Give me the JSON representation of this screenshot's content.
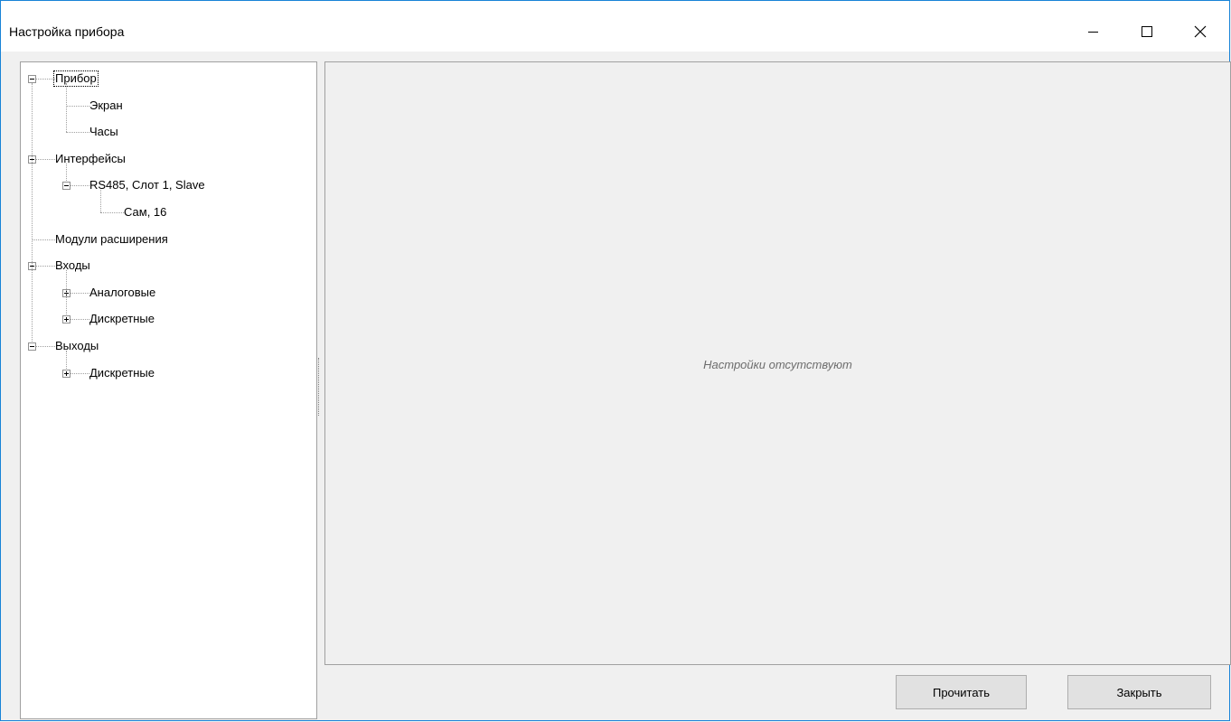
{
  "window": {
    "title": "Настройка прибора",
    "controls": {
      "minimize": "minimize",
      "maximize": "maximize",
      "close": "close"
    }
  },
  "tree": {
    "nodes": [
      {
        "label": "Прибор",
        "level": 0,
        "expanded": true,
        "selected": true
      },
      {
        "label": "Экран",
        "level": 1
      },
      {
        "label": "Часы",
        "level": 1
      },
      {
        "label": "Интерфейсы",
        "level": 0,
        "expanded": true
      },
      {
        "label": "RS485, Слот 1, Slave",
        "level": 1,
        "expanded": true
      },
      {
        "label": "Сам, 16",
        "level": 2
      },
      {
        "label": "Модули расширения",
        "level": 0
      },
      {
        "label": "Входы",
        "level": 0,
        "expanded": true
      },
      {
        "label": "Аналоговые",
        "level": 1,
        "expanded": false
      },
      {
        "label": "Дискретные",
        "level": 1,
        "expanded": false
      },
      {
        "label": "Выходы",
        "level": 0,
        "expanded": true
      },
      {
        "label": "Дискретные",
        "level": 1,
        "expanded": false
      }
    ]
  },
  "content": {
    "empty_message": "Настройки отсутствуют"
  },
  "buttons": {
    "read_label": "Прочитать",
    "close_label": "Закрыть"
  },
  "colors": {
    "window_border": "#1883d7",
    "background": "#f0f0f0",
    "button_face": "#e1e1e1"
  }
}
